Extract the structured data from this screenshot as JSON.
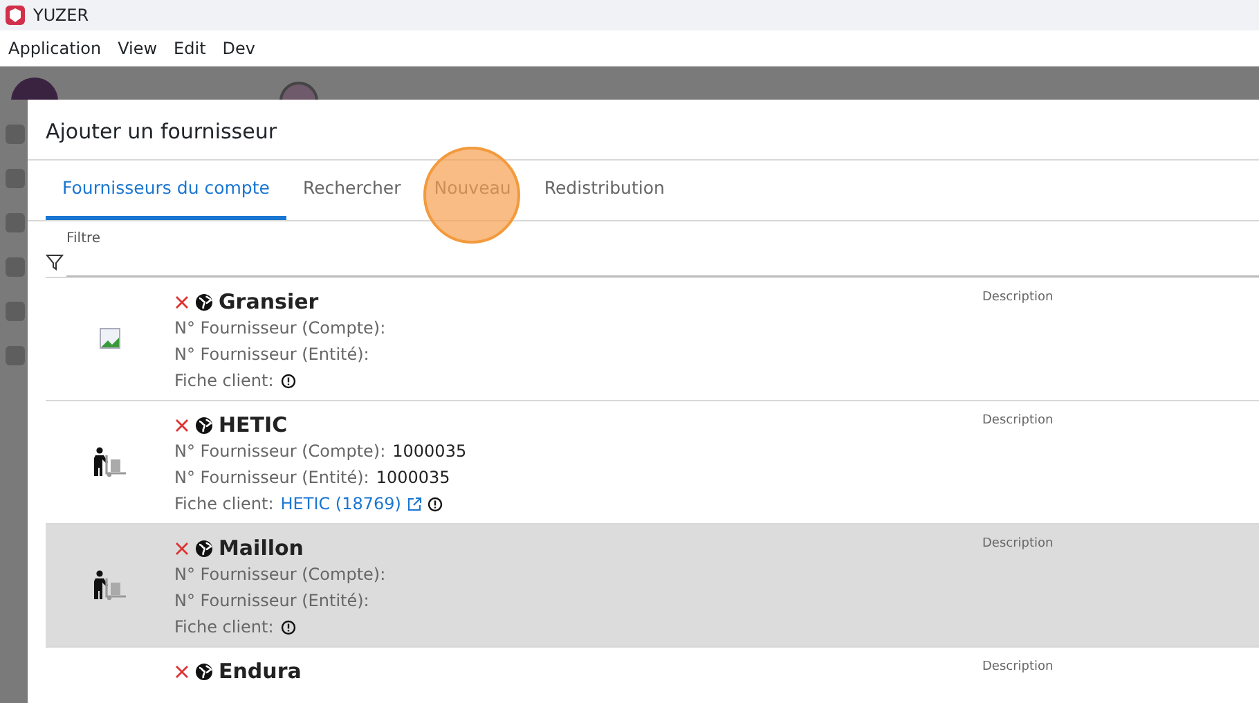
{
  "window": {
    "title": "YUZER"
  },
  "menu": [
    "Application",
    "View",
    "Edit",
    "Dev"
  ],
  "dialog": {
    "title": "Ajouter un fournisseur",
    "tabs": [
      {
        "label": "Fournisseurs du compte",
        "selected": true
      },
      {
        "label": "Rechercher",
        "selected": false
      },
      {
        "label": "Nouveau",
        "selected": false,
        "click_highlight": true
      },
      {
        "label": "Redistribution",
        "selected": false
      }
    ],
    "filter": {
      "label": "Filtre"
    },
    "suppliers": [
      {
        "name": "Gransier",
        "kind": "broken-image",
        "selected": false,
        "account_label": "N° Fournisseur (Compte):",
        "entity_label": "N° Fournisseur (Entité):",
        "client_label": "Fiche client:",
        "description": "Description"
      },
      {
        "name": "HETIC",
        "kind": "worker",
        "selected": false,
        "account_label": "N° Fournisseur (Compte):",
        "account_no": "1000035",
        "entity_label": "N° Fournisseur (Entité):",
        "entity_no": "1000035",
        "client_label": "Fiche client:",
        "client_link": "HETIC (18769)",
        "description": "Description"
      },
      {
        "name": "Maillon",
        "kind": "worker",
        "selected": true,
        "account_label": "N° Fournisseur (Compte):",
        "entity_label": "N° Fournisseur (Entité):",
        "client_label": "Fiche client:",
        "description": "Description"
      },
      {
        "name": "Endura",
        "selected": false,
        "description": "Description"
      }
    ]
  }
}
